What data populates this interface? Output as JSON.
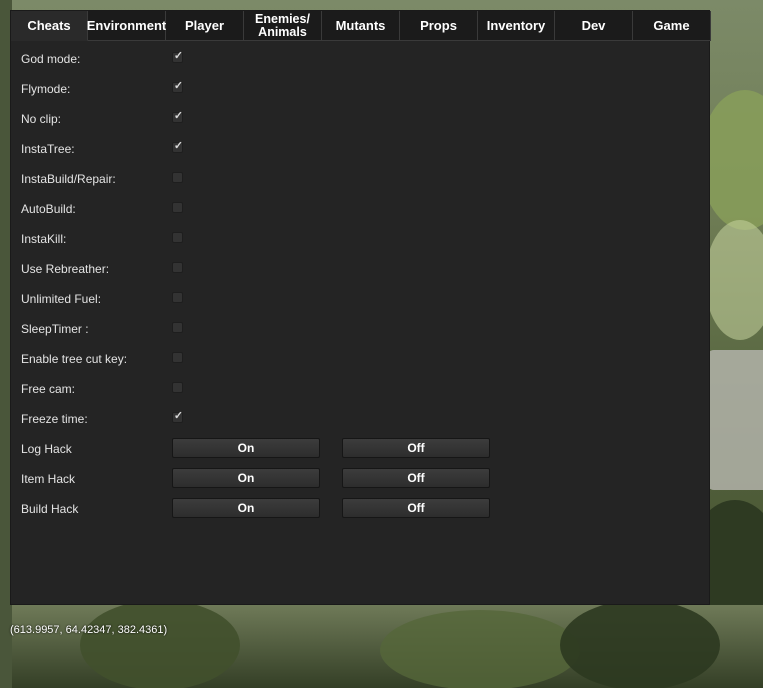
{
  "tabs": [
    {
      "label": "Cheats",
      "active": true
    },
    {
      "label": "Environment"
    },
    {
      "label": "Player"
    },
    {
      "label": "Enemies/\nAnimals"
    },
    {
      "label": "Mutants"
    },
    {
      "label": "Props"
    },
    {
      "label": "Inventory"
    },
    {
      "label": "Dev"
    },
    {
      "label": "Game"
    }
  ],
  "cheats": [
    {
      "label": "God mode:",
      "checked": true
    },
    {
      "label": "Flymode:",
      "checked": true
    },
    {
      "label": "No clip:",
      "checked": true
    },
    {
      "label": "InstaTree:",
      "checked": true
    },
    {
      "label": "InstaBuild/Repair:",
      "checked": false
    },
    {
      "label": "AutoBuild:",
      "checked": false
    },
    {
      "label": "InstaKill:",
      "checked": false
    },
    {
      "label": "Use Rebreather:",
      "checked": false
    },
    {
      "label": "Unlimited Fuel:",
      "checked": false
    },
    {
      "label": "SleepTimer :",
      "checked": false
    },
    {
      "label": "Enable tree cut key:",
      "checked": false
    },
    {
      "label": "Free cam:",
      "checked": false
    },
    {
      "label": "Freeze time:",
      "checked": true
    }
  ],
  "hacks": [
    {
      "label": "Log Hack",
      "on_label": "On",
      "off_label": "Off"
    },
    {
      "label": "Item Hack",
      "on_label": "On",
      "off_label": "Off"
    },
    {
      "label": "Build Hack",
      "on_label": "On",
      "off_label": "Off"
    }
  ],
  "checkmark_glyph": "✓",
  "coordinates": "(613.9957, 64.42347, 382.4361)"
}
